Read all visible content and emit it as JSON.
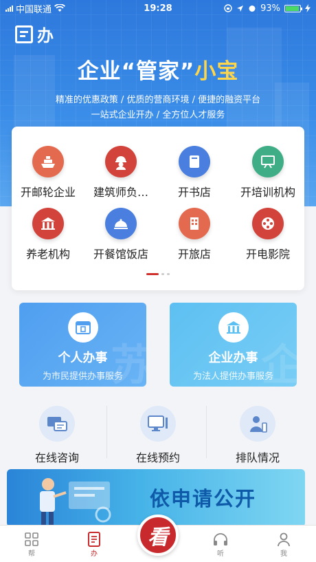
{
  "status_bar": {
    "carrier": "中国联通",
    "time": "19:28",
    "battery": "93%",
    "battery_fraction": 0.93
  },
  "header": {
    "logo_text": "办"
  },
  "hero": {
    "title_part1": "企业“管家”",
    "title_part2": "小宝",
    "subtitle1": "精准的优惠政策 / 优质的营商环境 / 便捷的融资平台",
    "subtitle2": "一站式企业开办 / 全方位人才服务"
  },
  "services": [
    {
      "label": "开邮轮企业",
      "icon": "ship-icon",
      "color": "#e46a4f"
    },
    {
      "label": "建筑师负…",
      "icon": "worker-icon",
      "color": "#d2433b"
    },
    {
      "label": "开书店",
      "icon": "book-icon",
      "color": "#4a7fe0"
    },
    {
      "label": "开培训机构",
      "icon": "board-icon",
      "color": "#3fae86"
    },
    {
      "label": "养老机构",
      "icon": "building-icon",
      "color": "#d2433b"
    },
    {
      "label": "开餐馆饭店",
      "icon": "dish-icon",
      "color": "#4a7fe0"
    },
    {
      "label": "开旅店",
      "icon": "hotel-icon",
      "color": "#e46a4f"
    },
    {
      "label": "开电影院",
      "icon": "film-icon",
      "color": "#d2433b"
    }
  ],
  "personal": {
    "title": "个人办事",
    "subtitle": "为市民提供办事服务",
    "watermark": "苏",
    "color_from": "#4f9ef0",
    "color_to": "#69b4f5"
  },
  "enterprise": {
    "title": "企业办事",
    "subtitle": "为法人提供办事服务",
    "watermark": "企",
    "color_from": "#5dc0f2",
    "color_to": "#79cdf5"
  },
  "quick_links": [
    {
      "label": "在线咨询",
      "icon": "chat-icon"
    },
    {
      "label": "在线预约",
      "icon": "computer-icon"
    },
    {
      "label": "排队情况",
      "icon": "queue-icon"
    }
  ],
  "banner": {
    "text": "依申请公开"
  },
  "tabbar": {
    "items": [
      {
        "label": "帮",
        "icon": "grid-icon"
      },
      {
        "label": "办",
        "icon": "document-icon"
      },
      {
        "label": "听",
        "icon": "headphones-icon"
      },
      {
        "label": "我",
        "icon": "user-icon"
      }
    ],
    "center_glyph": "看"
  },
  "colors": {
    "accent_red": "#c8292c",
    "primary_blue": "#2d78dc",
    "highlight_yellow": "#ffd54a"
  }
}
